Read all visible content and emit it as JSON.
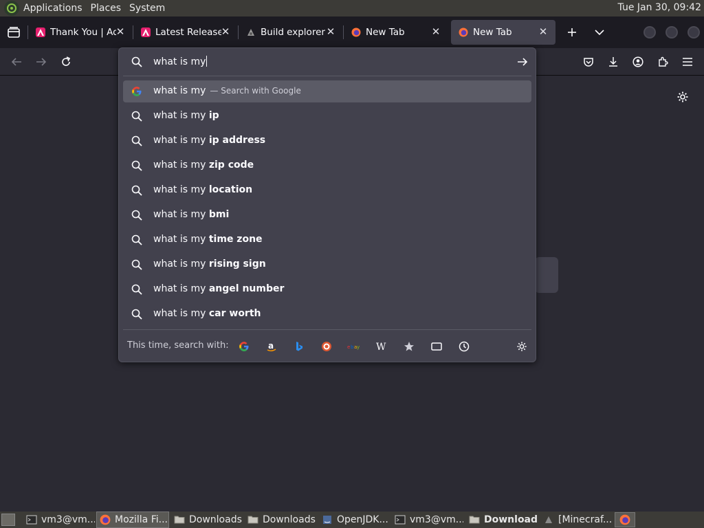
{
  "top_panel": {
    "menus": [
      "Applications",
      "Places",
      "System"
    ],
    "clock": "Tue Jan 30, 09:42"
  },
  "tabs": [
    {
      "title": "Thank You | Adobe",
      "favicon": "adobe-icon",
      "active": false
    },
    {
      "title": "Latest Releases",
      "favicon": "adobe-icon",
      "active": false
    },
    {
      "title": "Build explorer | ",
      "favicon": "build-icon",
      "active": false
    },
    {
      "title": "New Tab",
      "favicon": "firefox-icon",
      "active": false
    },
    {
      "title": "New Tab",
      "favicon": "firefox-icon",
      "active": true
    }
  ],
  "urlbar": {
    "typed": "what is my",
    "results": [
      {
        "prefix": "what is my",
        "suffix": "",
        "action": "— Search with Google",
        "icon": "google-icon",
        "selected": true
      },
      {
        "prefix": "what is my ",
        "suffix": "ip",
        "action": "",
        "icon": "search-icon",
        "selected": false
      },
      {
        "prefix": "what is my ",
        "suffix": "ip address",
        "action": "",
        "icon": "search-icon",
        "selected": false
      },
      {
        "prefix": "what is my ",
        "suffix": "zip code",
        "action": "",
        "icon": "search-icon",
        "selected": false
      },
      {
        "prefix": "what is my ",
        "suffix": "location",
        "action": "",
        "icon": "search-icon",
        "selected": false
      },
      {
        "prefix": "what is my ",
        "suffix": "bmi",
        "action": "",
        "icon": "search-icon",
        "selected": false
      },
      {
        "prefix": "what is my ",
        "suffix": "time zone",
        "action": "",
        "icon": "search-icon",
        "selected": false
      },
      {
        "prefix": "what is my ",
        "suffix": "rising sign",
        "action": "",
        "icon": "search-icon",
        "selected": false
      },
      {
        "prefix": "what is my ",
        "suffix": "angel number",
        "action": "",
        "icon": "search-icon",
        "selected": false
      },
      {
        "prefix": "what is my ",
        "suffix": "car worth",
        "action": "",
        "icon": "search-icon",
        "selected": false
      }
    ],
    "oneoff_label": "This time, search with:",
    "engines": [
      "google-icon",
      "amazon-icon",
      "bing-icon",
      "duckduckgo-icon",
      "ebay-icon",
      "wikipedia-icon",
      "bookmarks-icon",
      "tabs-icon",
      "history-icon"
    ]
  },
  "taskbar": {
    "items": [
      {
        "label": "vm3@vm...",
        "icon": "terminal-icon"
      },
      {
        "label": "Mozilla Fi...",
        "icon": "firefox-icon",
        "active": true
      },
      {
        "label": "Downloads",
        "icon": "folder-icon"
      },
      {
        "label": "Downloads",
        "icon": "folder-icon"
      },
      {
        "label": "OpenJDK...",
        "icon": "java-icon"
      },
      {
        "label": "vm3@vm...",
        "icon": "terminal-icon"
      },
      {
        "label": "Downloads",
        "icon": "folder-icon",
        "bold": true
      },
      {
        "label": "[Minecraf...",
        "icon": "minecraft-icon"
      }
    ]
  }
}
